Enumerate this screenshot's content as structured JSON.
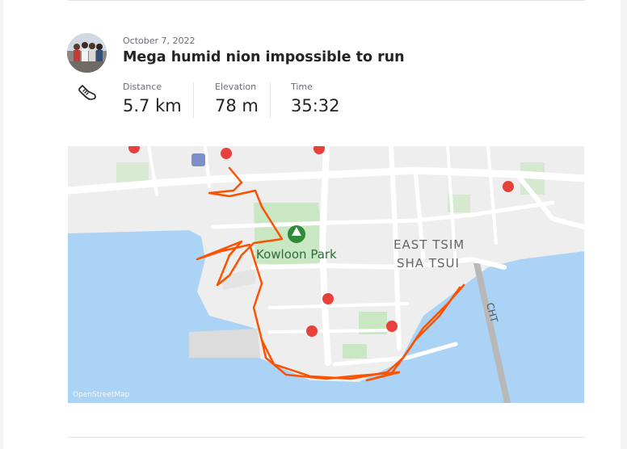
{
  "activity": {
    "date": "October 7, 2022",
    "title": "Mega humid nion impossible to run",
    "sport_icon": "running-shoe-icon",
    "stats": [
      {
        "label": "Distance",
        "value": "5.7 km"
      },
      {
        "label": "Elevation",
        "value": "78 m"
      },
      {
        "label": "Time",
        "value": "35:32"
      }
    ]
  },
  "map": {
    "labels": {
      "park": "Kowloon Park",
      "district_line1": "EAST TSIM",
      "district_line2": "SHA TSUI",
      "road": "CHT",
      "attribution": "OpenStreetMap"
    },
    "route_color": "#fc5200",
    "water_color": "#aad3f5",
    "land_color": "#eeeeee",
    "park_color": "#c9e7c2"
  }
}
